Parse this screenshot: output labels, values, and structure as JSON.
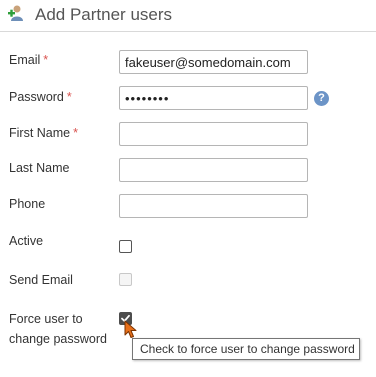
{
  "header": {
    "title": "Add Partner users",
    "icon": "add-user-icon"
  },
  "form": {
    "required_marker": "*",
    "email": {
      "label": "Email",
      "value": "fakeuser@somedomain.com"
    },
    "password": {
      "label": "Password",
      "value": "••••••••",
      "help_icon": "question-icon",
      "help_glyph": "?"
    },
    "first_name": {
      "label": "First Name",
      "value": ""
    },
    "last_name": {
      "label": "Last Name",
      "value": ""
    },
    "phone": {
      "label": "Phone",
      "value": ""
    },
    "active": {
      "label": "Active",
      "checked": false
    },
    "send_email": {
      "label": "Send Email",
      "checked": false,
      "disabled": true
    },
    "force_change": {
      "label_line1": "Force user to",
      "label_line2": "change password",
      "checked": true
    }
  },
  "tooltip": {
    "text": "Check to force user to change password"
  },
  "colors": {
    "required": "#d9534f",
    "help_icon": "#6c94c7",
    "header_icon_green": "#2e9e3a",
    "cursor": "#e8701a"
  }
}
